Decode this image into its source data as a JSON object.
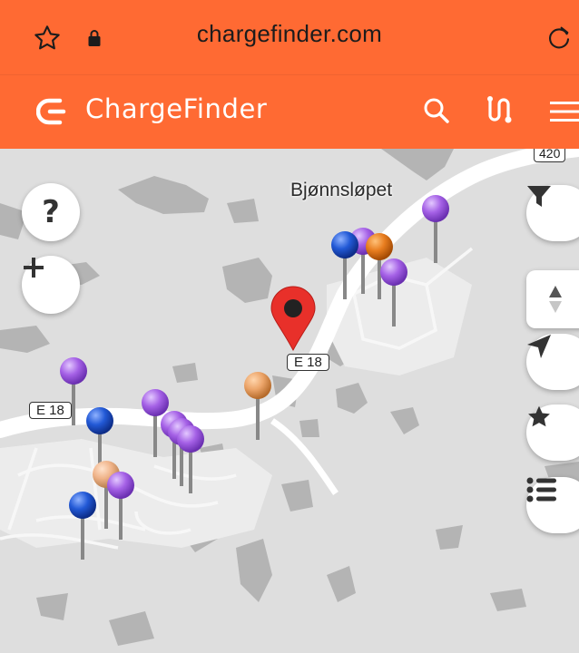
{
  "browser": {
    "url": "chargefinder.com",
    "icons": [
      "bookmark-star-icon",
      "lock-icon",
      "reload-icon"
    ],
    "accent_color": "#ff6a33"
  },
  "app": {
    "brand": "ChargeFinder",
    "icons": [
      "chargefinder-logo-icon",
      "search-icon",
      "route-icon",
      "menu-icon"
    ]
  },
  "map": {
    "place_label": "Bjønnsløpet",
    "road_shields": [
      "E 18",
      "E 18",
      "420"
    ],
    "left_controls": [
      "help-button",
      "zoom-in-button"
    ],
    "right_controls": [
      "filter-button",
      "compass-button",
      "locate-button",
      "favorites-button",
      "list-button"
    ],
    "pin_colors": {
      "blue": "#2259d6",
      "purple": "#a561e6",
      "orange": "#e87d1f",
      "light_orange": "#eca56a",
      "peach": "#f0b48a",
      "location": "#e8302a"
    }
  }
}
